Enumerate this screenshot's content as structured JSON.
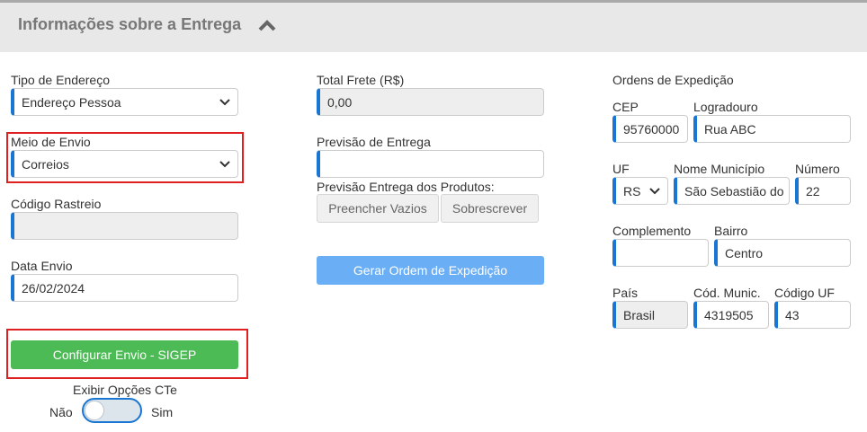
{
  "header": {
    "title": "Informações sobre a Entrega"
  },
  "left": {
    "tipo_endereco": {
      "label": "Tipo de Endereço",
      "value": "Endereço Pessoa"
    },
    "meio_envio": {
      "label": "Meio de Envio",
      "value": "Correios"
    },
    "codigo_rastreio": {
      "label": "Código Rastreio",
      "value": ""
    },
    "data_envio": {
      "label": "Data Envio",
      "value": "26/02/2024"
    },
    "configurar_button": "Configurar Envio - SIGEP",
    "cte": {
      "label": "Exibir Opções CTe",
      "no": "Não",
      "yes": "Sim",
      "enabled": false
    }
  },
  "middle": {
    "total_frete": {
      "label": "Total Frete (R$)",
      "value": "0,00"
    },
    "previsao_entrega": {
      "label": "Previsão de Entrega",
      "value": ""
    },
    "previsao_produtos": {
      "label": "Previsão Entrega dos Produtos:",
      "fill_button": "Preencher Vazios",
      "overwrite_button": "Sobrescrever"
    },
    "gerar_button": "Gerar Ordem de Expedição"
  },
  "right": {
    "section_title": "Ordens de Expedição",
    "cep": {
      "label": "CEP",
      "value": "95760000"
    },
    "logradouro": {
      "label": "Logradouro",
      "value": "Rua ABC"
    },
    "uf": {
      "label": "UF",
      "value": "RS"
    },
    "municipio": {
      "label": "Nome Município",
      "value": "São Sebastião do"
    },
    "numero": {
      "label": "Número",
      "value": "22"
    },
    "complemento": {
      "label": "Complemento",
      "value": ""
    },
    "bairro": {
      "label": "Bairro",
      "value": "Centro"
    },
    "pais": {
      "label": "País",
      "value": "Brasil"
    },
    "cod_munic": {
      "label": "Cód. Munic.",
      "value": "4319505"
    },
    "cod_uf": {
      "label": "Código UF",
      "value": "43"
    }
  },
  "colors": {
    "accent": "#1976d2",
    "highlight": "#e02020",
    "green_button": "#4cbb55",
    "blue_button": "#6aaef5"
  }
}
